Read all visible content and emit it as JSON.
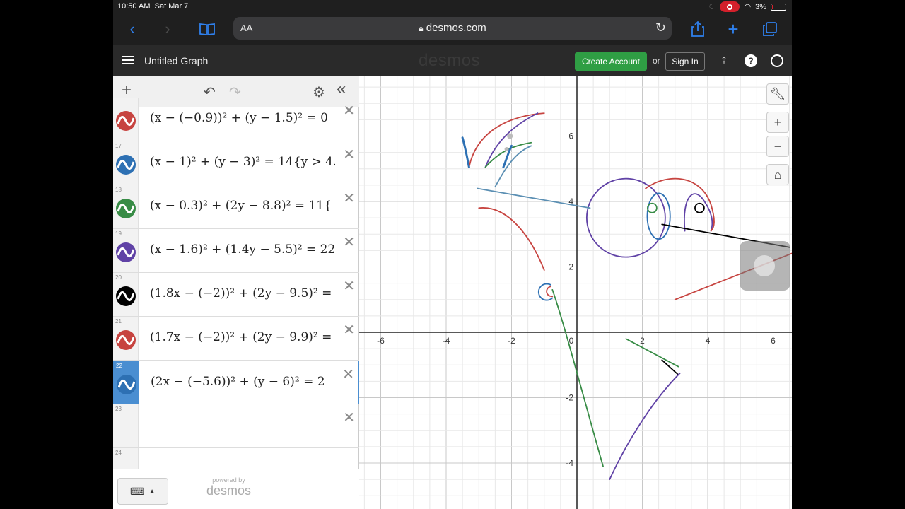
{
  "status": {
    "time": "10:50 AM",
    "date": "Sat Mar 7",
    "battery": "3%"
  },
  "browser": {
    "text_size": "AA",
    "url": "desmos.com",
    "back_icon": "chevron-left-icon",
    "forward_icon": "chevron-right-icon",
    "bookmarks_icon": "book-icon",
    "reload_icon": "reload-icon",
    "share_icon": "share-icon",
    "new_tab_icon": "plus-icon",
    "tabs_icon": "tabs-icon"
  },
  "header": {
    "title": "Untitled Graph",
    "logo": "desmos",
    "create_account": "Create Account",
    "or": "or",
    "sign_in": "Sign In",
    "help": "?"
  },
  "expressions": [
    {
      "num": "",
      "latex": "(x − (−0.9))² + (y − 1.5)² = 0",
      "color": "#c74440"
    },
    {
      "num": "17",
      "latex": "(x − 1)² + (y − 3)² = 14{y > 4.",
      "color": "#2d70b3"
    },
    {
      "num": "18",
      "latex": "(x − 0.3)² + (2y − 8.8)² = 11{",
      "color": "#388c46"
    },
    {
      "num": "19",
      "latex": "(x − 1.6)² + (1.4y − 5.5)² = 22",
      "color": "#6042a6"
    },
    {
      "num": "20",
      "latex": "(1.8x − (−2))² + (2y − 9.5)² =",
      "color": "#000000"
    },
    {
      "num": "21",
      "latex": "(1.7x − (−2))² + (2y − 9.9)² =",
      "color": "#c74440"
    },
    {
      "num": "22",
      "latex": "(2x − (−5.6))² + (y − 6)² = 2",
      "color": "#2d70b3"
    },
    {
      "num": "23",
      "latex": "",
      "color": ""
    },
    {
      "num": "24",
      "latex": "",
      "color": ""
    }
  ],
  "footer": {
    "powered_by": "powered by",
    "brand": "desmos"
  },
  "graph": {
    "x_ticks": [
      "-6",
      "-4",
      "-2",
      "0",
      "2",
      "4",
      "6"
    ],
    "y_ticks": [
      "6",
      "4",
      "2",
      "-2",
      "-4"
    ],
    "colors": {
      "red": "#c74440",
      "blue": "#2d70b3",
      "green": "#388c46",
      "purple": "#6042a6",
      "black": "#000000",
      "steel": "#5b8fb3"
    }
  }
}
